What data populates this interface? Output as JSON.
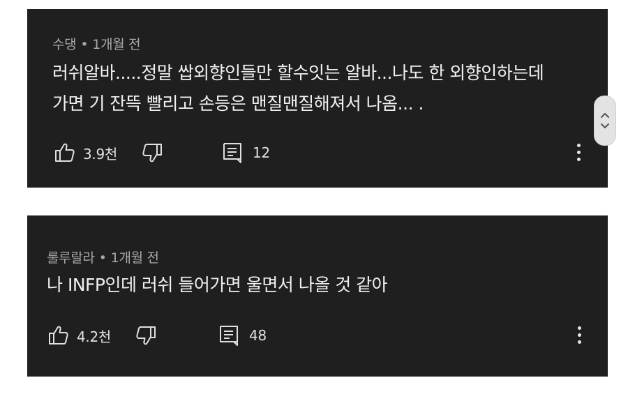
{
  "comments": [
    {
      "author": "수댕",
      "separator": "•",
      "time": "1개월 전",
      "lines": [
        "러쉬알바.....정말 쌉외향인들만 할수잇는 알바...나도 한 외향인하는데",
        "가면 기 잔뜩 빨리고 손등은 맨질맨질해져서 나옴... ."
      ],
      "likes": "3.9천",
      "replies": "12"
    },
    {
      "author": "룰루랄라",
      "separator": "•",
      "time": "1개월 전",
      "lines": [
        "나 INFP인데 러쉬 들어가면 울면서 나올 것 같아"
      ],
      "likes": "4.2천",
      "replies": "48"
    }
  ],
  "icons": {
    "like": "thumbs-up-icon",
    "dislike": "thumbs-down-icon",
    "reply": "reply-comment-icon",
    "more": "more-vertical-icon",
    "scroll_up": "chevron-up-icon",
    "scroll_down": "chevron-down-icon"
  },
  "colors": {
    "card_background": "#1f1f1f",
    "page_background": "#ffffff",
    "text_primary": "#f1f1f1",
    "text_secondary": "#a8a8a8"
  }
}
